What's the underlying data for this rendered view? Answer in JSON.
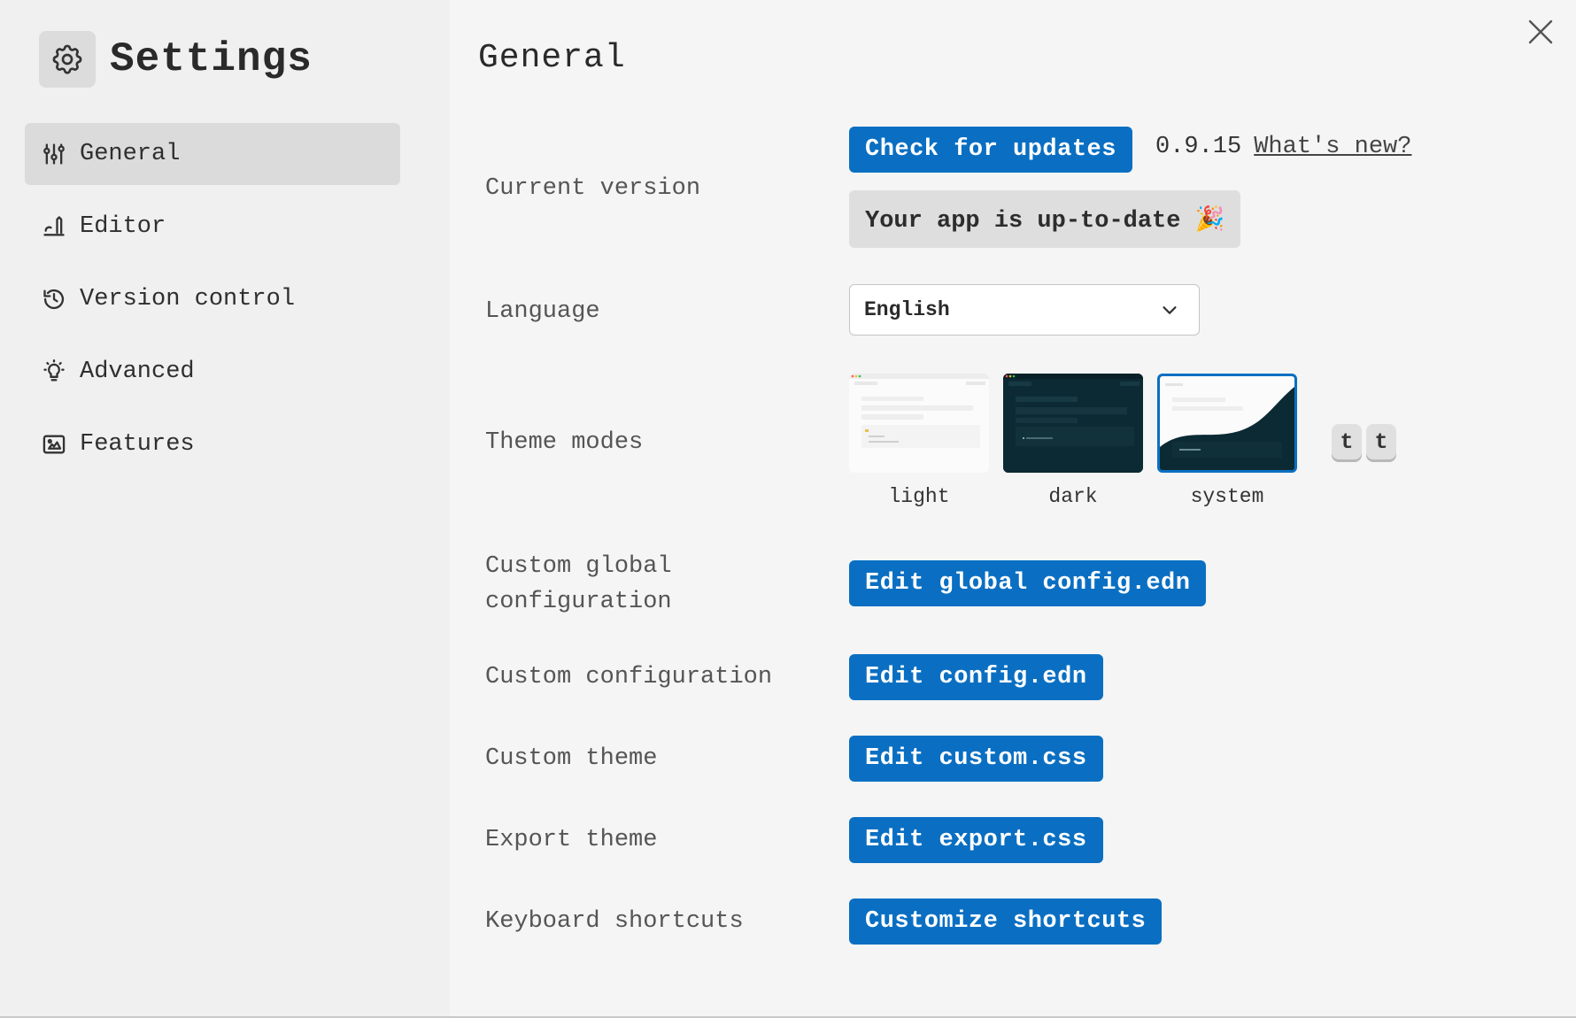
{
  "sidebar": {
    "title": "Settings",
    "items": [
      {
        "label": "General",
        "icon": "sliders-icon",
        "active": true
      },
      {
        "label": "Editor",
        "icon": "pen-icon",
        "active": false
      },
      {
        "label": "Version control",
        "icon": "history-icon",
        "active": false
      },
      {
        "label": "Advanced",
        "icon": "lightbulb-icon",
        "active": false
      },
      {
        "label": "Features",
        "icon": "image-icon",
        "active": false
      }
    ]
  },
  "main": {
    "title": "General",
    "current_version": {
      "label": "Current version",
      "check_button": "Check for updates",
      "version": "0.9.15",
      "whats_new": "What's new?",
      "status": "Your app is up-to-date 🎉"
    },
    "language": {
      "label": "Language",
      "selected": "English"
    },
    "theme": {
      "label": "Theme modes",
      "options": [
        "light",
        "dark",
        "system"
      ],
      "selected": "system",
      "shortcut_keys": [
        "t",
        "t"
      ]
    },
    "custom_global_config": {
      "label_line1": "Custom global",
      "label_line2": "configuration",
      "button": "Edit global config.edn"
    },
    "custom_config": {
      "label": "Custom configuration",
      "button": "Edit config.edn"
    },
    "custom_theme": {
      "label": "Custom theme",
      "button": "Edit custom.css"
    },
    "export_theme": {
      "label": "Export theme",
      "button": "Edit export.css"
    },
    "keyboard_shortcuts": {
      "label": "Keyboard shortcuts",
      "button": "Customize shortcuts"
    }
  },
  "colors": {
    "accent": "#0a6fc2",
    "dark_theme": "#0c2a33",
    "sidebar_bg": "#f0f0f0",
    "main_bg": "#f5f5f5"
  }
}
